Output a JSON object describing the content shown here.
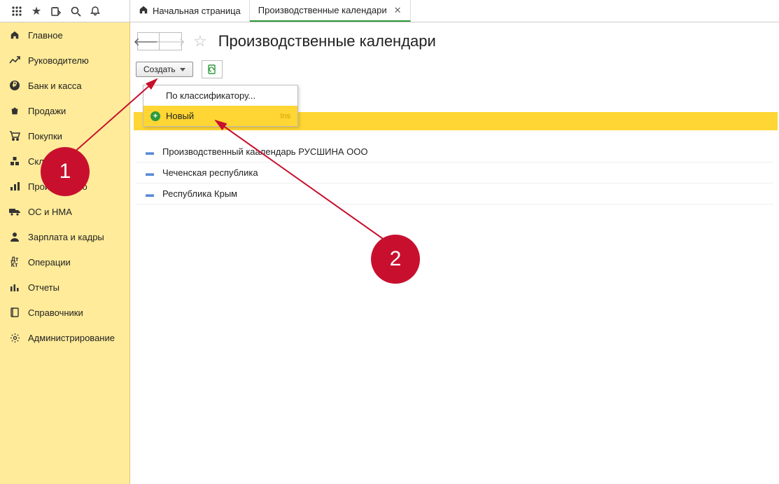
{
  "top_icons": [
    "apps",
    "star",
    "inbox",
    "search",
    "bell"
  ],
  "tabs": [
    {
      "label": "Начальная страница",
      "active": false,
      "closable": false
    },
    {
      "label": "Производственные календари",
      "active": true,
      "closable": true
    }
  ],
  "sidebar": {
    "items": [
      {
        "icon": "home",
        "label": "Главное"
      },
      {
        "icon": "trend",
        "label": "Руководителю"
      },
      {
        "icon": "ruble",
        "label": "Банк и касса"
      },
      {
        "icon": "bag",
        "label": "Продажи"
      },
      {
        "icon": "cart",
        "label": "Покупки"
      },
      {
        "icon": "boxes",
        "label": "Склад"
      },
      {
        "icon": "chart",
        "label": "Производство"
      },
      {
        "icon": "truck",
        "label": "ОС и НМА"
      },
      {
        "icon": "person",
        "label": "Зарплата и кадры"
      },
      {
        "icon": "dtkt",
        "label": "Операции"
      },
      {
        "icon": "bars",
        "label": "Отчеты"
      },
      {
        "icon": "book",
        "label": "Справочники"
      },
      {
        "icon": "gear",
        "label": "Администрирование"
      }
    ]
  },
  "page": {
    "title": "Производственные календари",
    "create_label": "Создать"
  },
  "dropdown": {
    "item_classifier": "По классификатору...",
    "item_new": "Новый",
    "hint_new": "Ins"
  },
  "list": {
    "rows": [
      "Производственный каалендарь РУСШИНА ООО",
      "Чеченская республика",
      "Республика Крым"
    ]
  },
  "annotations": {
    "badge1": "1",
    "badge2": "2"
  }
}
